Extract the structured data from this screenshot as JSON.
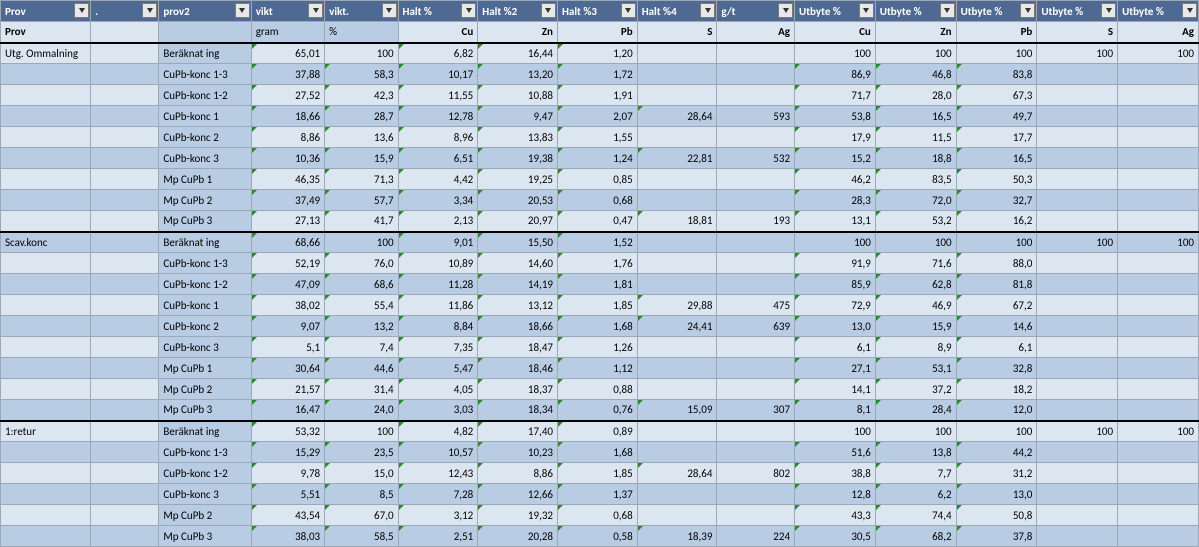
{
  "hdr1": [
    "Prov",
    ".",
    "prov2",
    "vikt",
    "vikt.",
    "Halt %",
    "Halt %2",
    "Halt %3",
    "Halt %4",
    "g/t",
    "Utbyte %",
    "Utbyte %",
    "Utbyte %",
    "Utbyte %",
    "Utbyte %"
  ],
  "hdr2": [
    "Prov",
    "",
    "",
    "gram",
    "%",
    "Cu",
    "Zn",
    "Pb",
    "S",
    "Ag",
    "Cu",
    "Zn",
    "Pb",
    "S",
    "Ag"
  ],
  "groups": [
    {
      "name": "Utg. Ommalning",
      "rows": [
        {
          "p": "Beräknat ing",
          "v": [
            "65,01",
            "100",
            "6,82",
            "16,44",
            "1,20",
            "",
            "",
            "100",
            "100",
            "100",
            "100",
            "100"
          ]
        },
        {
          "p": "CuPb-konc 1-3",
          "v": [
            "37,88",
            "58,3",
            "10,17",
            "13,20",
            "1,72",
            "",
            "",
            "86,9",
            "46,8",
            "83,8",
            "",
            ""
          ]
        },
        {
          "p": "CuPb-konc 1-2",
          "v": [
            "27,52",
            "42,3",
            "11,55",
            "10,88",
            "1,91",
            "",
            "",
            "71,7",
            "28,0",
            "67,3",
            "",
            ""
          ]
        },
        {
          "p": "CuPb-konc 1",
          "v": [
            "18,66",
            "28,7",
            "12,78",
            "9,47",
            "2,07",
            "28,64",
            "593",
            "53,8",
            "16,5",
            "49,7",
            "",
            ""
          ]
        },
        {
          "p": "CuPb-konc 2",
          "v": [
            "8,86",
            "13,6",
            "8,96",
            "13,83",
            "1,55",
            "",
            "",
            "17,9",
            "11,5",
            "17,7",
            "",
            ""
          ]
        },
        {
          "p": "CuPb-konc 3",
          "v": [
            "10,36",
            "15,9",
            "6,51",
            "19,38",
            "1,24",
            "22,81",
            "532",
            "15,2",
            "18,8",
            "16,5",
            "",
            ""
          ]
        },
        {
          "p": "Mp CuPb 1",
          "v": [
            "46,35",
            "71,3",
            "4,42",
            "19,25",
            "0,85",
            "",
            "",
            "46,2",
            "83,5",
            "50,3",
            "",
            ""
          ]
        },
        {
          "p": "Mp CuPb 2",
          "v": [
            "37,49",
            "57,7",
            "3,34",
            "20,53",
            "0,68",
            "",
            "",
            "28,3",
            "72,0",
            "32,7",
            "",
            ""
          ]
        },
        {
          "p": "Mp CuPb 3",
          "v": [
            "27,13",
            "41,7",
            "2,13",
            "20,97",
            "0,47",
            "18,81",
            "193",
            "13,1",
            "53,2",
            "16,2",
            "",
            ""
          ]
        }
      ]
    },
    {
      "name": "Scav.konc",
      "rows": [
        {
          "p": "Beräknat ing",
          "v": [
            "68,66",
            "100",
            "9,01",
            "15,50",
            "1,52",
            "",
            "",
            "100",
            "100",
            "100",
            "100",
            "100"
          ]
        },
        {
          "p": "CuPb-konc 1-3",
          "v": [
            "52,19",
            "76,0",
            "10,89",
            "14,60",
            "1,76",
            "",
            "",
            "91,9",
            "71,6",
            "88,0",
            "",
            ""
          ]
        },
        {
          "p": "CuPb-konc 1-2",
          "v": [
            "47,09",
            "68,6",
            "11,28",
            "14,19",
            "1,81",
            "",
            "",
            "85,9",
            "62,8",
            "81,8",
            "",
            ""
          ]
        },
        {
          "p": "CuPb-konc 1",
          "v": [
            "38,02",
            "55,4",
            "11,86",
            "13,12",
            "1,85",
            "29,88",
            "475",
            "72,9",
            "46,9",
            "67,2",
            "",
            ""
          ]
        },
        {
          "p": "CuPb-konc 2",
          "v": [
            "9,07",
            "13,2",
            "8,84",
            "18,66",
            "1,68",
            "24,41",
            "639",
            "13,0",
            "15,9",
            "14,6",
            "",
            ""
          ]
        },
        {
          "p": "CuPb-konc 3",
          "v": [
            "5,1",
            "7,4",
            "7,35",
            "18,47",
            "1,26",
            "",
            "",
            "6,1",
            "8,9",
            "6,1",
            "",
            ""
          ]
        },
        {
          "p": "Mp CuPb 1",
          "v": [
            "30,64",
            "44,6",
            "5,47",
            "18,46",
            "1,12",
            "",
            "",
            "27,1",
            "53,1",
            "32,8",
            "",
            ""
          ]
        },
        {
          "p": "Mp CuPb 2",
          "v": [
            "21,57",
            "31,4",
            "4,05",
            "18,37",
            "0,88",
            "",
            "",
            "14,1",
            "37,2",
            "18,2",
            "",
            ""
          ]
        },
        {
          "p": "Mp CuPb 3",
          "v": [
            "16,47",
            "24,0",
            "3,03",
            "18,34",
            "0,76",
            "15,09",
            "307",
            "8,1",
            "28,4",
            "12,0",
            "",
            ""
          ]
        }
      ]
    },
    {
      "name": "1:retur",
      "rows": [
        {
          "p": "Beräknat ing",
          "v": [
            "53,32",
            "100",
            "4,82",
            "17,40",
            "0,89",
            "",
            "",
            "100",
            "100",
            "100",
            "100",
            "100"
          ]
        },
        {
          "p": "CuPb-konc 1-3",
          "v": [
            "15,29",
            "23,5",
            "10,57",
            "10,23",
            "1,68",
            "",
            "",
            "51,6",
            "13,8",
            "44,2",
            "",
            ""
          ]
        },
        {
          "p": "CuPb-konc 1-2",
          "v": [
            "9,78",
            "15,0",
            "12,43",
            "8,86",
            "1,85",
            "28,64",
            "802",
            "38,8",
            "7,7",
            "31,2",
            "",
            ""
          ]
        },
        {
          "p": "CuPb-konc 3",
          "v": [
            "5,51",
            "8,5",
            "7,28",
            "12,66",
            "1,37",
            "",
            "",
            "12,8",
            "6,2",
            "13,0",
            "",
            ""
          ]
        },
        {
          "p": "Mp CuPb 2",
          "v": [
            "43,54",
            "67,0",
            "3,12",
            "19,32",
            "0,68",
            "",
            "",
            "43,3",
            "74,4",
            "50,8",
            "",
            ""
          ]
        },
        {
          "p": "Mp CuPb 3",
          "v": [
            "38,03",
            "58,5",
            "2,51",
            "20,28",
            "0,58",
            "18,39",
            "224",
            "30,5",
            "68,2",
            "37,8",
            "",
            ""
          ]
        }
      ]
    }
  ]
}
